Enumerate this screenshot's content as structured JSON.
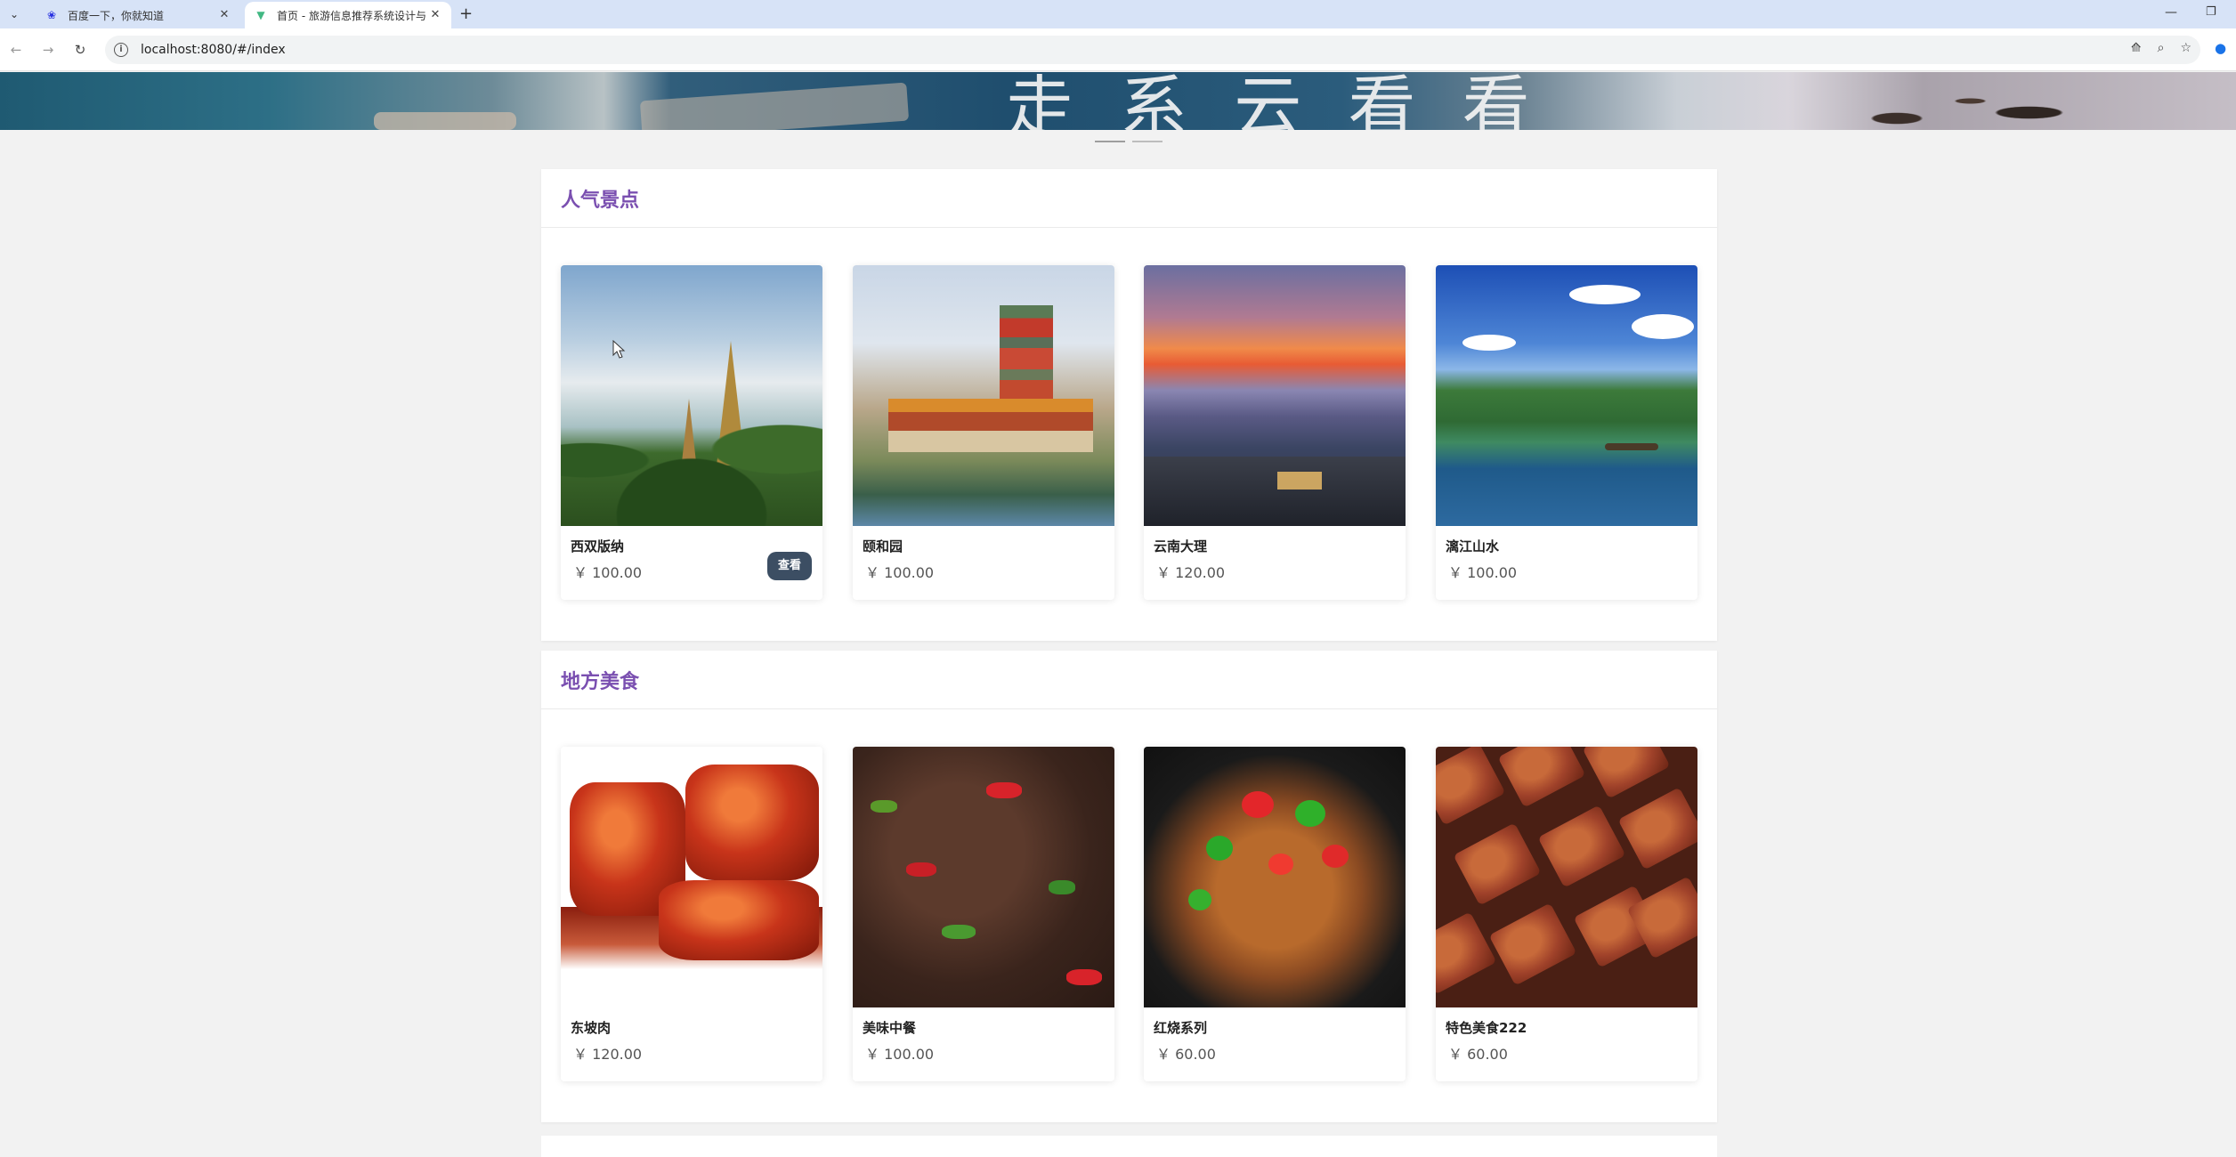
{
  "browser": {
    "tabs": [
      {
        "title": "百度一下，你就知道",
        "active": false,
        "favicon": "baidu-icon"
      },
      {
        "title": "首页 - 旅游信息推荐系统设计与",
        "active": true,
        "favicon": "vue-icon"
      }
    ],
    "url": "localhost:8080/#/index",
    "colors": {
      "tabbar": "#d7e3f7",
      "accent": "#1a73e8"
    }
  },
  "banner": {
    "text": "走 系 云 看 看"
  },
  "sections": [
    {
      "title": "人气景点",
      "items": [
        {
          "name": "西双版纳",
          "price": "￥ 100.00",
          "image": "xishuangbanna-pagoda",
          "button": "查看"
        },
        {
          "name": "颐和园",
          "price": "￥ 100.00",
          "image": "summer-palace-tower"
        },
        {
          "name": "云南大理",
          "price": "￥ 120.00",
          "image": "dali-sunset-town"
        },
        {
          "name": "漓江山水",
          "price": "￥ 100.00",
          "image": "lijiang-river-karst"
        }
      ]
    },
    {
      "title": "地方美食",
      "items": [
        {
          "name": "东坡肉",
          "price": "￥ 120.00",
          "image": "dongpo-pork"
        },
        {
          "name": "美味中餐",
          "price": "￥ 100.00",
          "image": "stir-fried-liver-peppers"
        },
        {
          "name": "红烧系列",
          "price": "￥ 60.00",
          "image": "braised-intestine-peppers"
        },
        {
          "name": "特色美食222",
          "price": "￥ 60.00",
          "image": "fried-tofu-squares"
        }
      ]
    }
  ],
  "theme": {
    "section_title_color": "#7a4fb0",
    "button_color": "#3c4e63"
  }
}
